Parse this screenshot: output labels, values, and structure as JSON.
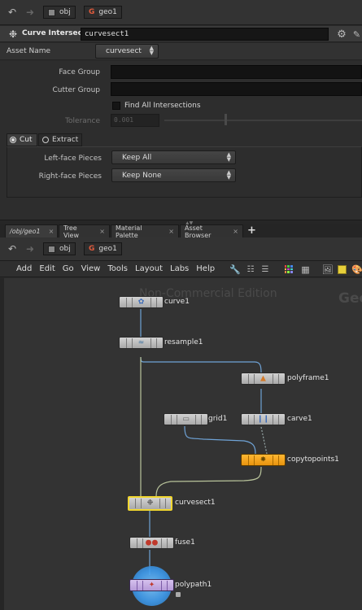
{
  "top_path": {
    "crumb1": "obj",
    "crumb2": "geo1"
  },
  "param_header": {
    "node_type": "Curve Intersect",
    "node_name": "curvesect1"
  },
  "asset": {
    "label": "Asset Name",
    "value": "curvesect"
  },
  "params": {
    "face_group_label": "Face Group",
    "cutter_group_label": "Cutter Group",
    "find_all_label": "Find All Intersections",
    "tolerance_label": "Tolerance",
    "tolerance_value": "0.001",
    "cut_label": "Cut",
    "extract_label": "Extract",
    "left_label": "Left-face Pieces",
    "left_value": "Keep All",
    "right_label": "Right-face Pieces",
    "right_value": "Keep None"
  },
  "tabs": [
    {
      "label": "/obj/geo1"
    },
    {
      "label": "Tree View"
    },
    {
      "label": "Material Palette"
    },
    {
      "label": "Asset Browser"
    }
  ],
  "add_tab": "+",
  "tab_close": "×",
  "net_path": {
    "crumb1": "obj",
    "crumb2": "geo1"
  },
  "menu": [
    "Add",
    "Edit",
    "Go",
    "View",
    "Tools",
    "Layout",
    "Labs",
    "Help"
  ],
  "watermark": {
    "text": "Non-Commercial Edition",
    "context": "Geo"
  },
  "nodes": [
    {
      "id": "curve1",
      "name": "curve1",
      "color": "#c8c8c8"
    },
    {
      "id": "resample1",
      "name": "resample1",
      "color": "#c8c8c8"
    },
    {
      "id": "polyframe1",
      "name": "polyframe1",
      "color": "#c8c8c8"
    },
    {
      "id": "grid1",
      "name": "grid1",
      "color": "#c8c8c8"
    },
    {
      "id": "carve1",
      "name": "carve1",
      "color": "#c8c8c8"
    },
    {
      "id": "copytopoints1",
      "name": "copytopoints1",
      "color": "#f2a31b"
    },
    {
      "id": "curvesect1",
      "name": "curvesect1",
      "color": "#e8d44a"
    },
    {
      "id": "fuse1",
      "name": "fuse1",
      "color": "#c8c8c8"
    },
    {
      "id": "polypath1",
      "name": "polypath1",
      "color": "#3fa7ff"
    }
  ]
}
